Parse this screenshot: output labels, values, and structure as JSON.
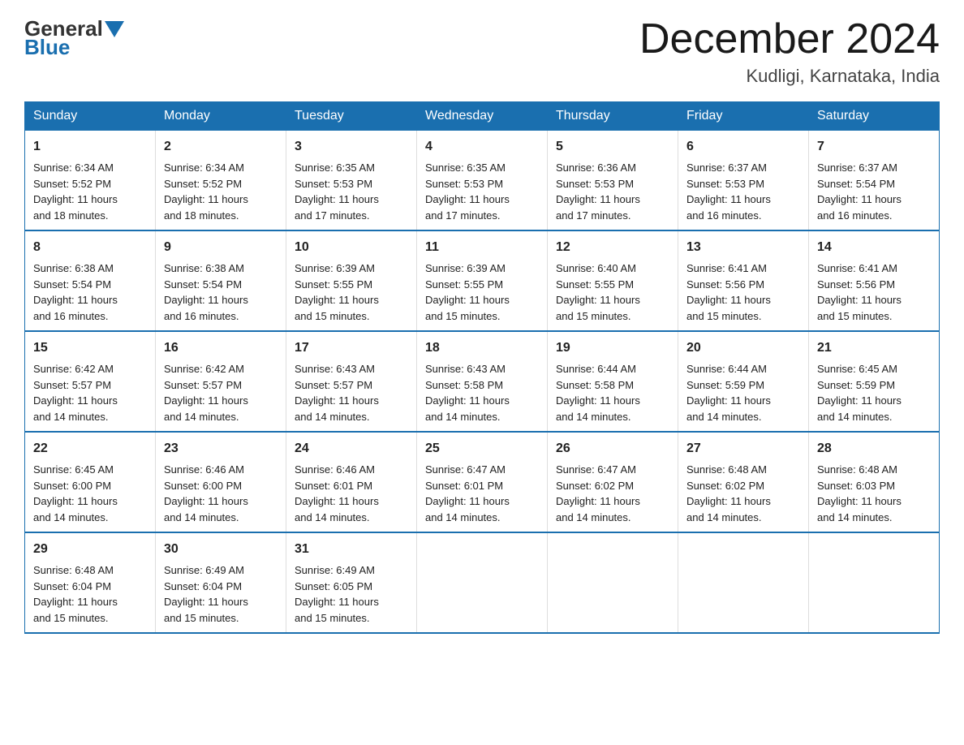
{
  "header": {
    "logo_general": "General",
    "logo_blue": "Blue",
    "month_title": "December 2024",
    "location": "Kudligi, Karnataka, India"
  },
  "weekdays": [
    "Sunday",
    "Monday",
    "Tuesday",
    "Wednesday",
    "Thursday",
    "Friday",
    "Saturday"
  ],
  "weeks": [
    [
      {
        "day": "1",
        "sunrise": "6:34 AM",
        "sunset": "5:52 PM",
        "daylight": "11 hours and 18 minutes."
      },
      {
        "day": "2",
        "sunrise": "6:34 AM",
        "sunset": "5:52 PM",
        "daylight": "11 hours and 18 minutes."
      },
      {
        "day": "3",
        "sunrise": "6:35 AM",
        "sunset": "5:53 PM",
        "daylight": "11 hours and 17 minutes."
      },
      {
        "day": "4",
        "sunrise": "6:35 AM",
        "sunset": "5:53 PM",
        "daylight": "11 hours and 17 minutes."
      },
      {
        "day": "5",
        "sunrise": "6:36 AM",
        "sunset": "5:53 PM",
        "daylight": "11 hours and 17 minutes."
      },
      {
        "day": "6",
        "sunrise": "6:37 AM",
        "sunset": "5:53 PM",
        "daylight": "11 hours and 16 minutes."
      },
      {
        "day": "7",
        "sunrise": "6:37 AM",
        "sunset": "5:54 PM",
        "daylight": "11 hours and 16 minutes."
      }
    ],
    [
      {
        "day": "8",
        "sunrise": "6:38 AM",
        "sunset": "5:54 PM",
        "daylight": "11 hours and 16 minutes."
      },
      {
        "day": "9",
        "sunrise": "6:38 AM",
        "sunset": "5:54 PM",
        "daylight": "11 hours and 16 minutes."
      },
      {
        "day": "10",
        "sunrise": "6:39 AM",
        "sunset": "5:55 PM",
        "daylight": "11 hours and 15 minutes."
      },
      {
        "day": "11",
        "sunrise": "6:39 AM",
        "sunset": "5:55 PM",
        "daylight": "11 hours and 15 minutes."
      },
      {
        "day": "12",
        "sunrise": "6:40 AM",
        "sunset": "5:55 PM",
        "daylight": "11 hours and 15 minutes."
      },
      {
        "day": "13",
        "sunrise": "6:41 AM",
        "sunset": "5:56 PM",
        "daylight": "11 hours and 15 minutes."
      },
      {
        "day": "14",
        "sunrise": "6:41 AM",
        "sunset": "5:56 PM",
        "daylight": "11 hours and 15 minutes."
      }
    ],
    [
      {
        "day": "15",
        "sunrise": "6:42 AM",
        "sunset": "5:57 PM",
        "daylight": "11 hours and 14 minutes."
      },
      {
        "day": "16",
        "sunrise": "6:42 AM",
        "sunset": "5:57 PM",
        "daylight": "11 hours and 14 minutes."
      },
      {
        "day": "17",
        "sunrise": "6:43 AM",
        "sunset": "5:57 PM",
        "daylight": "11 hours and 14 minutes."
      },
      {
        "day": "18",
        "sunrise": "6:43 AM",
        "sunset": "5:58 PM",
        "daylight": "11 hours and 14 minutes."
      },
      {
        "day": "19",
        "sunrise": "6:44 AM",
        "sunset": "5:58 PM",
        "daylight": "11 hours and 14 minutes."
      },
      {
        "day": "20",
        "sunrise": "6:44 AM",
        "sunset": "5:59 PM",
        "daylight": "11 hours and 14 minutes."
      },
      {
        "day": "21",
        "sunrise": "6:45 AM",
        "sunset": "5:59 PM",
        "daylight": "11 hours and 14 minutes."
      }
    ],
    [
      {
        "day": "22",
        "sunrise": "6:45 AM",
        "sunset": "6:00 PM",
        "daylight": "11 hours and 14 minutes."
      },
      {
        "day": "23",
        "sunrise": "6:46 AM",
        "sunset": "6:00 PM",
        "daylight": "11 hours and 14 minutes."
      },
      {
        "day": "24",
        "sunrise": "6:46 AM",
        "sunset": "6:01 PM",
        "daylight": "11 hours and 14 minutes."
      },
      {
        "day": "25",
        "sunrise": "6:47 AM",
        "sunset": "6:01 PM",
        "daylight": "11 hours and 14 minutes."
      },
      {
        "day": "26",
        "sunrise": "6:47 AM",
        "sunset": "6:02 PM",
        "daylight": "11 hours and 14 minutes."
      },
      {
        "day": "27",
        "sunrise": "6:48 AM",
        "sunset": "6:02 PM",
        "daylight": "11 hours and 14 minutes."
      },
      {
        "day": "28",
        "sunrise": "6:48 AM",
        "sunset": "6:03 PM",
        "daylight": "11 hours and 14 minutes."
      }
    ],
    [
      {
        "day": "29",
        "sunrise": "6:48 AM",
        "sunset": "6:04 PM",
        "daylight": "11 hours and 15 minutes."
      },
      {
        "day": "30",
        "sunrise": "6:49 AM",
        "sunset": "6:04 PM",
        "daylight": "11 hours and 15 minutes."
      },
      {
        "day": "31",
        "sunrise": "6:49 AM",
        "sunset": "6:05 PM",
        "daylight": "11 hours and 15 minutes."
      },
      null,
      null,
      null,
      null
    ]
  ],
  "labels": {
    "sunrise": "Sunrise:",
    "sunset": "Sunset:",
    "daylight": "Daylight:"
  }
}
